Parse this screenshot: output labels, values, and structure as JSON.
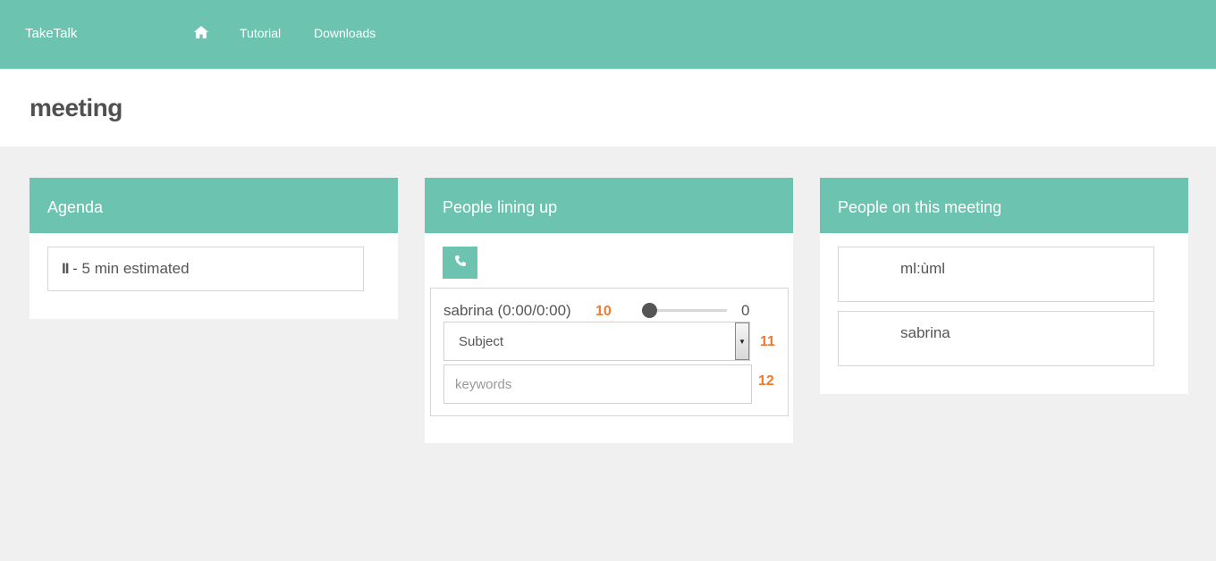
{
  "navbar": {
    "brand": "TakeTalk",
    "home_icon": "home-icon",
    "links": [
      "Tutorial",
      "Downloads"
    ]
  },
  "page": {
    "title": "meeting"
  },
  "agenda": {
    "title": "Agenda",
    "item": {
      "icon": "pause-icon",
      "icon_text": "II",
      "text": " - 5 min estimated"
    }
  },
  "queue": {
    "title": "People lining up",
    "call_icon": "phone-icon",
    "entry": {
      "name": "sabrina (0:00/0:00)",
      "slider_value": "0",
      "subject_selected": "Subject",
      "keywords_placeholder": "keywords",
      "keywords_value": ""
    },
    "markers": [
      "10",
      "11",
      "12"
    ]
  },
  "people": {
    "title": "People on this meeting",
    "members": [
      "ml:ùml",
      "sabrina"
    ]
  },
  "colors": {
    "accent": "#6cc4b0",
    "marker": "#f07a28",
    "background": "#f0f0f0"
  }
}
